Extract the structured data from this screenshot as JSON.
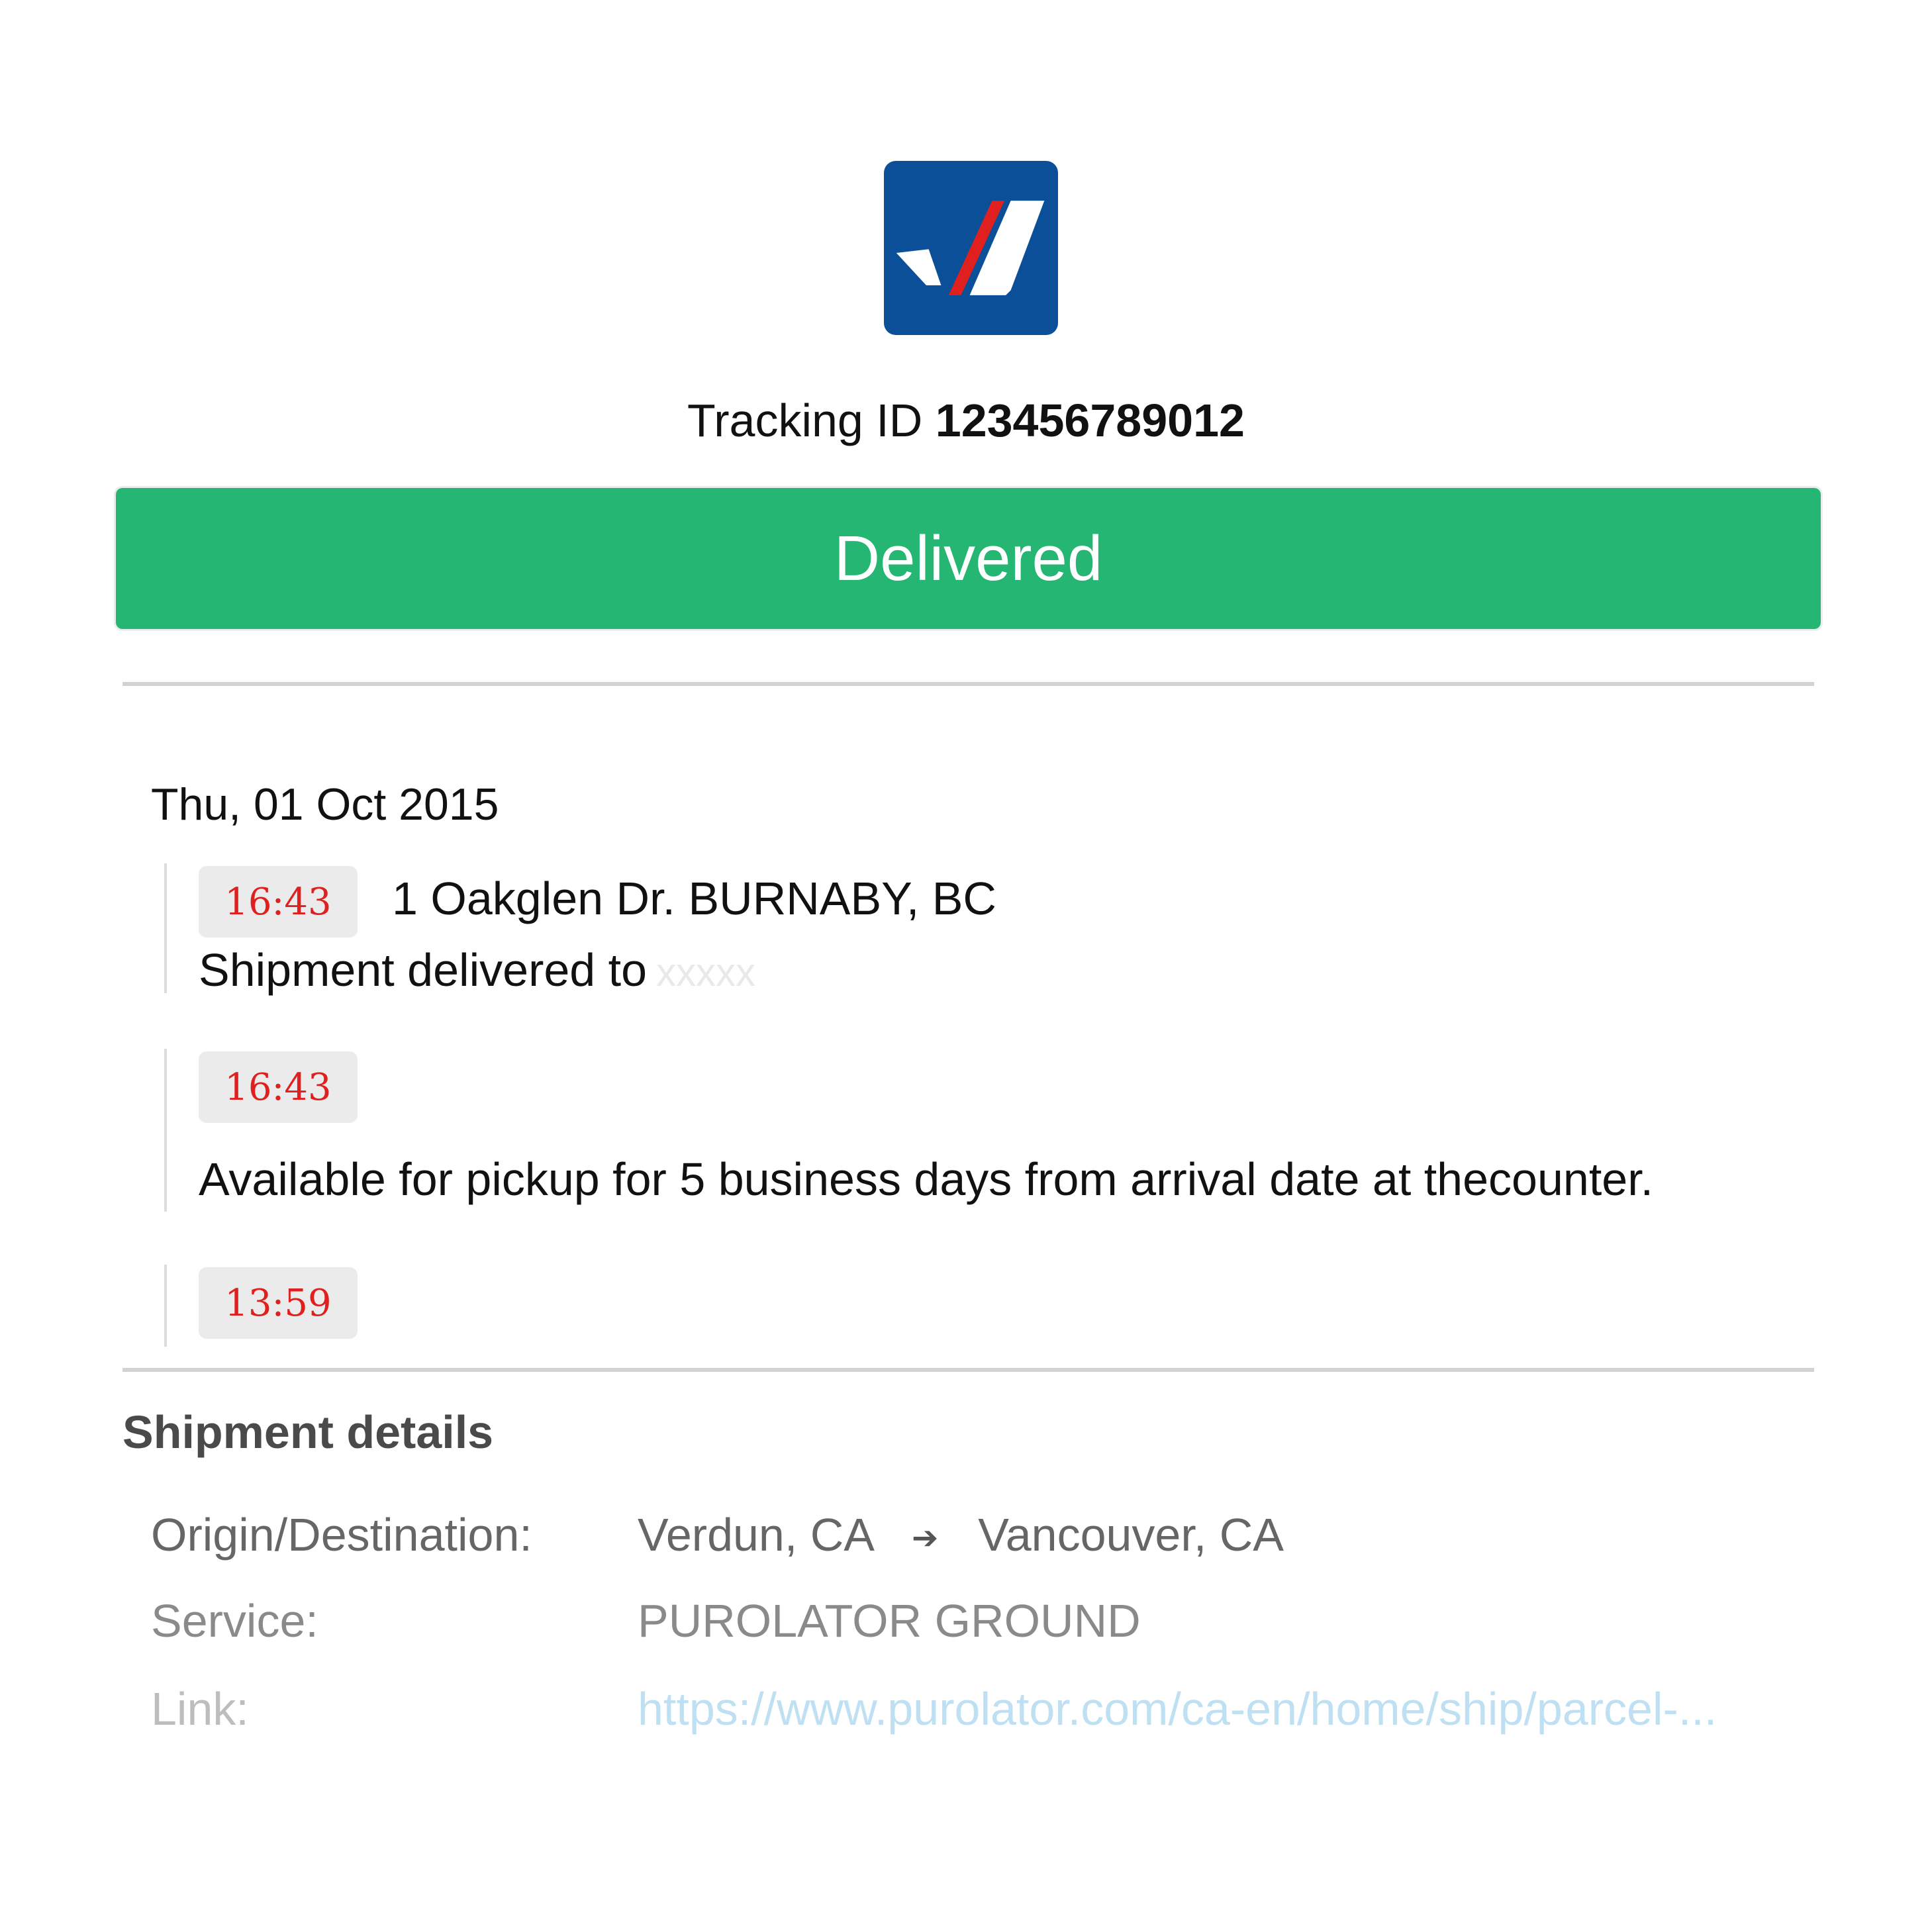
{
  "logo": {
    "icon": "purolator-check-logo-icon",
    "background_color": "#0b4f99",
    "accent_color": "#e0201f"
  },
  "tracking": {
    "label": "Tracking ID",
    "id": "123456789012"
  },
  "status": {
    "label": "Delivered",
    "color": "#26b673"
  },
  "history": {
    "date": "Thu, 01 Oct 2015",
    "events": [
      {
        "time": "16:43",
        "location": "1 Oakglen Dr. BURNABY, BC",
        "description": "Shipment delivered to",
        "redacted": "xxxxx"
      },
      {
        "time": "16:43",
        "description": "Available for pickup for 5 business days from arrival date at thecounter."
      },
      {
        "time": "13:59"
      }
    ]
  },
  "details": {
    "title": "Shipment details",
    "origin_label": "Origin/Destination:",
    "origin": "Verdun, CA",
    "arrow_icon": "arrow-right-icon",
    "destination": "Vancouver, CA",
    "service_label": "Service:",
    "service": "PUROLATOR GROUND",
    "link_label": "Link:",
    "link": "https://www.purolator.com/ca-en/home/ship/parcel-..."
  }
}
